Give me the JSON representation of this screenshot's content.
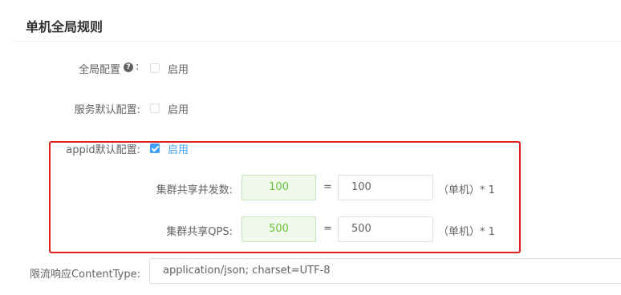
{
  "section_title": "单机全局规则",
  "global_config": {
    "label": "全局配置",
    "colon": ":",
    "checkbox_label": "启用",
    "checked": false
  },
  "service_default": {
    "label": "服务默认配置:",
    "checkbox_label": "启用",
    "checked": false
  },
  "appid_default": {
    "label": "appid默认配置:",
    "checkbox_label": "启用",
    "checked": true
  },
  "cluster_concurrency": {
    "label": "集群共享并发数:",
    "computed": "100",
    "equals": "=",
    "value": "100",
    "unit": "（单机）* 1"
  },
  "cluster_qps": {
    "label": "集群共享QPS:",
    "computed": "500",
    "equals": "=",
    "value": "500",
    "unit": "（单机）* 1"
  },
  "content_type": {
    "label": "限流响应ContentType:",
    "value": "application/json; charset=UTF-8"
  },
  "colors": {
    "accent": "#409eff",
    "highlight_border": "#e02020",
    "success": "#67c23a"
  }
}
